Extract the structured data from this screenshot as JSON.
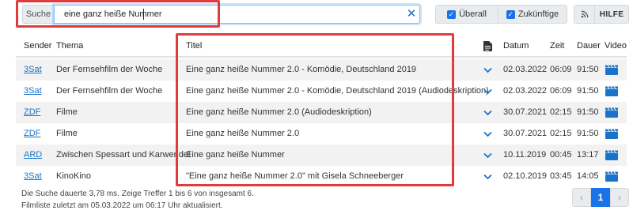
{
  "search": {
    "addon_label": "Suche",
    "value": "eine ganz heiße Nummer",
    "clear_icon": "close-icon"
  },
  "filters": {
    "ueberall": {
      "label": "Überall",
      "checked": true
    },
    "zukuenftige": {
      "label": "Zukünftige",
      "checked": true
    },
    "rss_icon": "rss-icon",
    "hilfe_label": "HILFE"
  },
  "table": {
    "headers": {
      "sender": "Sender",
      "thema": "Thema",
      "titel": "Titel",
      "datum": "Datum",
      "zeit": "Zeit",
      "dauer": "Dauer",
      "video": "Video"
    },
    "rows": [
      {
        "sender": "3Sat",
        "thema": "Der Fernsehfilm der Woche",
        "titel": "Eine ganz heiße Nummer 2.0 - Komödie, Deutschland 2019",
        "datum": "02.03.2022",
        "zeit": "06:09",
        "dauer": "91:50"
      },
      {
        "sender": "3Sat",
        "thema": "Der Fernsehfilm der Woche",
        "titel": "Eine ganz heiße Nummer 2.0 - Komödie, Deutschland 2019 (Audiodeskription)",
        "datum": "02.03.2022",
        "zeit": "06:09",
        "dauer": "91:50"
      },
      {
        "sender": "ZDF",
        "thema": "Filme",
        "titel": "Eine ganz heiße Nummer 2.0 (Audiodeskription)",
        "datum": "30.07.2021",
        "zeit": "02:15",
        "dauer": "91:50"
      },
      {
        "sender": "ZDF",
        "thema": "Filme",
        "titel": "Eine ganz heiße Nummer 2.0",
        "datum": "30.07.2021",
        "zeit": "02:15",
        "dauer": "91:50"
      },
      {
        "sender": "ARD",
        "thema": "Zwischen Spessart und Karwendel",
        "titel": "Eine ganz heiße Nummer",
        "datum": "10.11.2019",
        "zeit": "00:45",
        "dauer": "13:17"
      },
      {
        "sender": "3Sat",
        "thema": "KinoKino",
        "titel": "\"Eine ganz heiße Nummer 2.0\" mit Gisela Schneeberger",
        "datum": "02.10.2019",
        "zeit": "03:45",
        "dauer": "14:05"
      }
    ]
  },
  "footer": {
    "line1": "Die Suche dauerte 3,78 ms. Zeige Treffer 1 bis 6 von insgesamt 6.",
    "line2": "Filmliste zuletzt am 05.03.2022 um 06:17 Uhr aktualisiert."
  },
  "pagination": {
    "prev": "‹",
    "current": "1",
    "next": "›"
  },
  "colors": {
    "accent": "#1a73e8",
    "link": "#1a73c8",
    "highlight": "#e03c3c"
  }
}
